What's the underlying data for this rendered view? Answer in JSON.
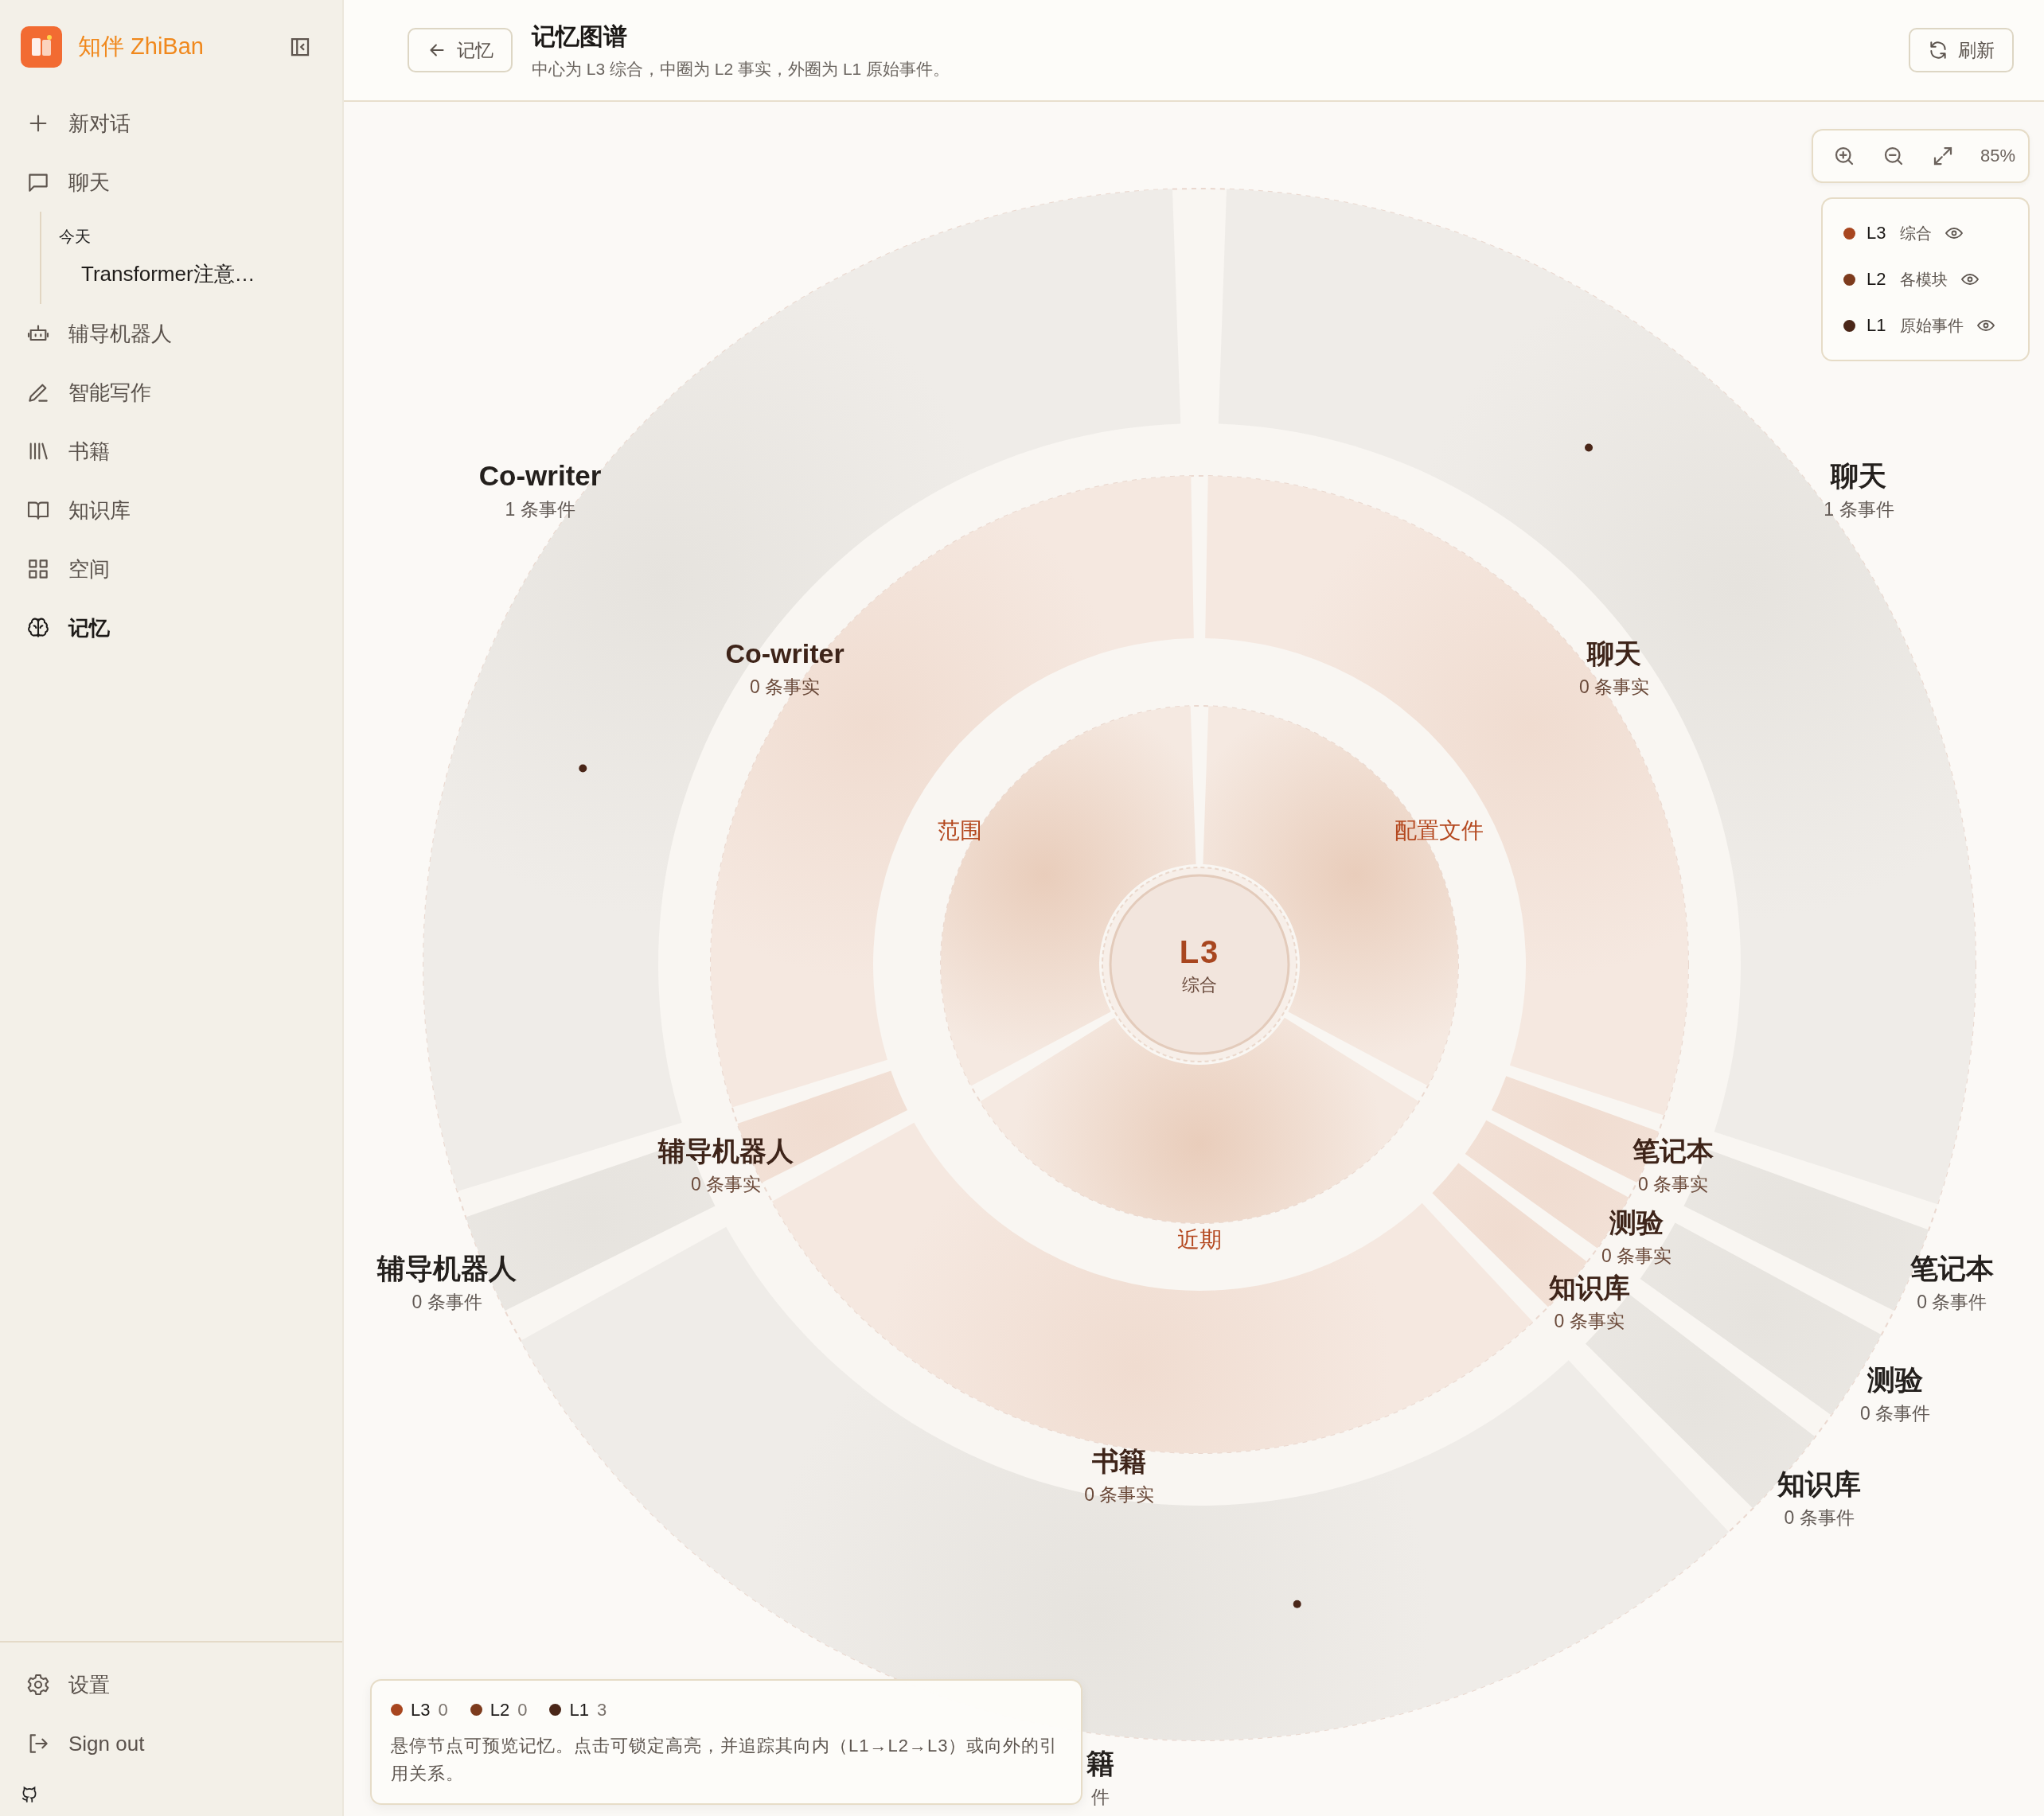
{
  "sidebar": {
    "brand": "知伴 ZhiBan",
    "items": [
      {
        "label": "新对话",
        "selected": false
      },
      {
        "label": "聊天",
        "selected": false,
        "children": [
          {
            "kind": "group",
            "label": "今天"
          },
          {
            "kind": "conversation",
            "label": "Transformer注意…",
            "selected": false
          }
        ]
      },
      {
        "label": "辅导机器人",
        "selected": false
      },
      {
        "label": "智能写作",
        "selected": false
      },
      {
        "label": "书籍",
        "selected": false
      },
      {
        "label": "知识库",
        "selected": false
      },
      {
        "label": "空间",
        "selected": false
      },
      {
        "label": "记忆",
        "selected": true
      }
    ],
    "footer_items": [
      {
        "label": "设置"
      },
      {
        "label": "Sign out"
      }
    ]
  },
  "header": {
    "back_button": "记忆",
    "title": "记忆图谱",
    "subtitle": "中心为 L3 综合，中圈为 L2 事实，外圈为 L1 原始事件。",
    "refresh_button": "刷新"
  },
  "zoom": {
    "value": "85%"
  },
  "legend": [
    {
      "level": "L3",
      "name": "综合",
      "color": "#a8461f",
      "visible": true
    },
    {
      "level": "L2",
      "name": "各模块",
      "color": "#7d3b1d",
      "visible": true
    },
    {
      "level": "L1",
      "name": "原始事件",
      "color": "#4a2618",
      "visible": true
    }
  ],
  "graph": {
    "center": {
      "title": "L3",
      "subtitle": "综合"
    },
    "inner": [
      {
        "label": "配置文件"
      },
      {
        "label": "近期"
      },
      {
        "label": "范围"
      }
    ],
    "middle": [
      {
        "label": "聊天",
        "count": "0 条事实"
      },
      {
        "label": "笔记本",
        "count": "0 条事实"
      },
      {
        "label": "测验",
        "count": "0 条事实"
      },
      {
        "label": "知识库",
        "count": "0 条事实"
      },
      {
        "label": "书籍",
        "count": "0 条事实"
      },
      {
        "label": "辅导机器人",
        "count": "0 条事实"
      },
      {
        "label": "Co-writer",
        "count": "0 条事实"
      }
    ],
    "outer": [
      {
        "label": "聊天",
        "count": "1 条事件",
        "events": [
          {
            "kind": "event"
          }
        ]
      },
      {
        "label": "笔记本",
        "count": "0 条事件"
      },
      {
        "label": "测验",
        "count": "0 条事件"
      },
      {
        "label": "知识库",
        "count": "0 条事件"
      },
      {
        "label": "籍",
        "count": "件",
        "events": [
          {
            "kind": "event"
          }
        ]
      },
      {
        "label": "辅导机器人",
        "count": "0 条事件"
      },
      {
        "label": "Co-writer",
        "count": "1 条事件",
        "events": [
          {
            "kind": "event"
          }
        ]
      }
    ]
  },
  "info": {
    "stats": [
      {
        "level": "L3",
        "value": "0",
        "color": "#a8461f"
      },
      {
        "level": "L2",
        "value": "0",
        "color": "#7d3b1d"
      },
      {
        "level": "L1",
        "value": "3",
        "color": "#4a2618"
      }
    ],
    "text": "悬停节点可预览记忆。点击可锁定高亮，并追踪其向内（L1→L2→L3）或向外的引用关系。"
  }
}
